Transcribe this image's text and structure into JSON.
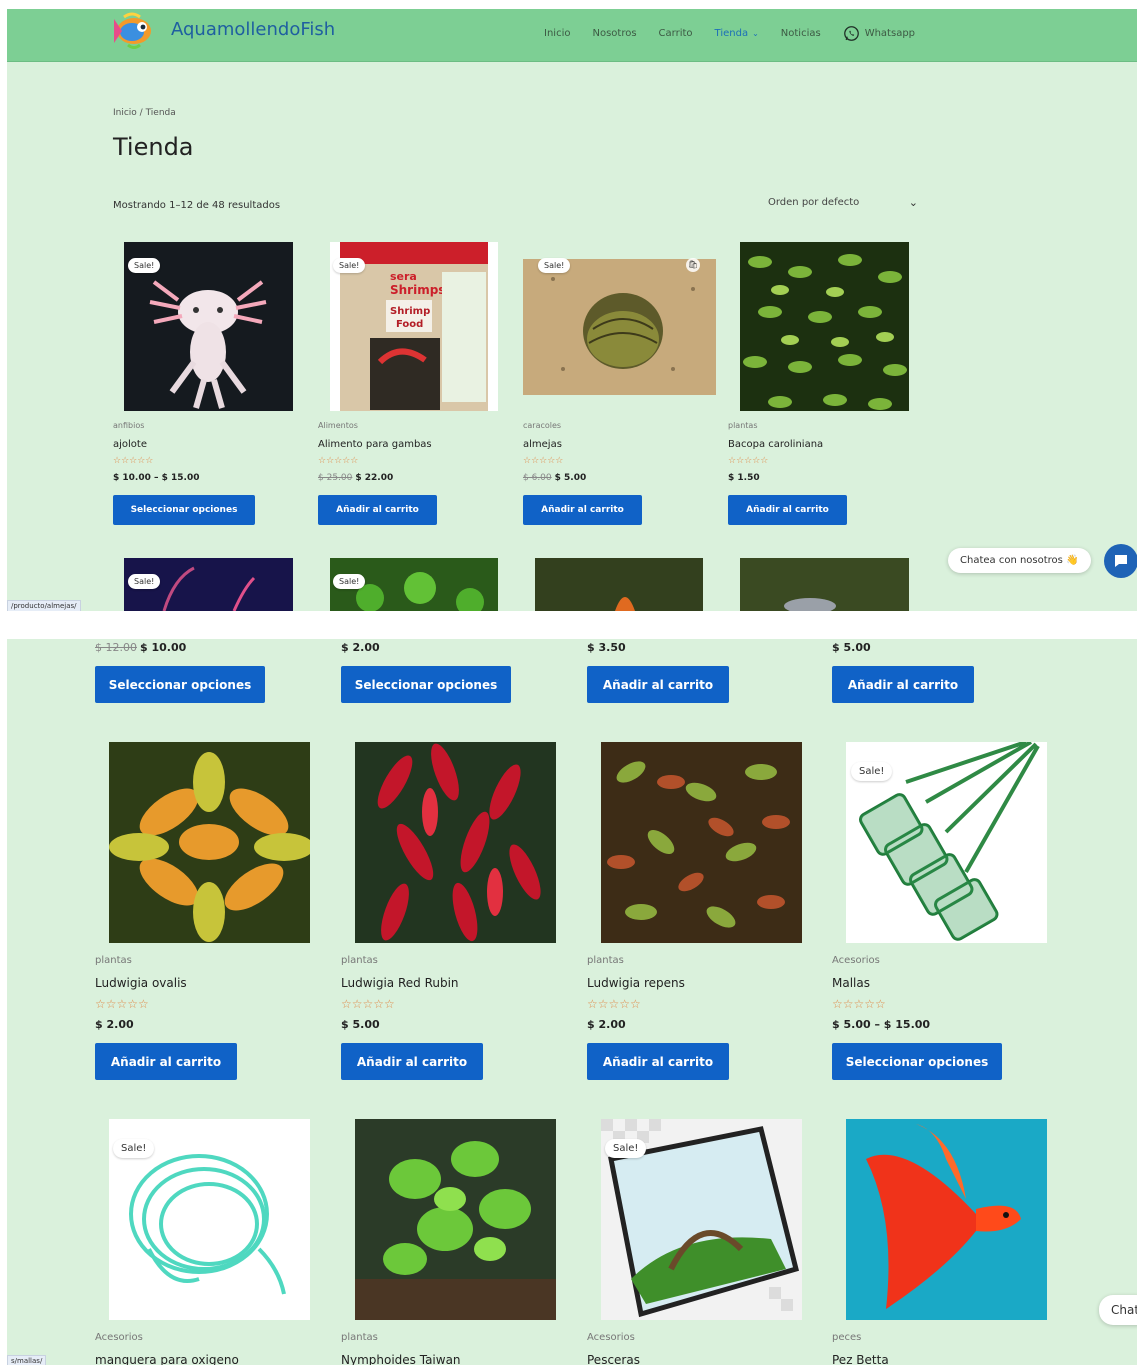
{
  "site": {
    "name": "AquamollendoFish"
  },
  "nav": {
    "items": [
      "Inicio",
      "Nosotros",
      "Carrito",
      "Tienda",
      "Noticias"
    ],
    "active": "Tienda",
    "whatsapp": "Whatsapp"
  },
  "shop": {
    "breadcrumb": "Inicio / Tienda",
    "title": "Tienda",
    "result_count": "Mostrando 1–12 de 48 resultados",
    "ordering": "Orden por defecto"
  },
  "sale_label": "Sale!",
  "rating_stars": "☆☆☆☆☆",
  "products_top": [
    {
      "category": "anfibios",
      "name": "ajolote",
      "price": "$ 10.00 – $ 15.00",
      "old_price": "",
      "button": "Seleccionar opciones",
      "sale": true
    },
    {
      "category": "Alimentos",
      "name": "Alimento para gambas",
      "price": "$ 22.00",
      "old_price": "$ 25.00",
      "button": "Añadir al carrito",
      "sale": true
    },
    {
      "category": "caracoles",
      "name": "almejas",
      "price": "$ 5.00",
      "old_price": "$ 6.00",
      "button": "Añadir al carrito",
      "sale": true
    },
    {
      "category": "plantas",
      "name": "Bacopa caroliniana",
      "price": "$ 1.50",
      "old_price": "",
      "button": "Añadir al carrito",
      "sale": false
    }
  ],
  "products_prev_row": [
    {
      "price": "$ 10.00",
      "old_price": "$ 12.00",
      "button": "Seleccionar opciones"
    },
    {
      "price": "$ 2.00",
      "old_price": "",
      "button": "Seleccionar opciones"
    },
    {
      "price": "$ 3.50",
      "old_price": "",
      "button": "Añadir al carrito"
    },
    {
      "price": "$ 5.00",
      "old_price": "",
      "button": "Añadir al carrito"
    }
  ],
  "products_mid": [
    {
      "category": "plantas",
      "name": "Ludwigia ovalis",
      "price": "$ 2.00",
      "button": "Añadir al carrito",
      "sale": false
    },
    {
      "category": "plantas",
      "name": "Ludwigia Red Rubin",
      "price": "$ 5.00",
      "button": "Añadir al carrito",
      "sale": false
    },
    {
      "category": "plantas",
      "name": "Ludwigia repens",
      "price": "$ 2.00",
      "button": "Añadir al carrito",
      "sale": false
    },
    {
      "category": "Acesorios",
      "name": "Mallas",
      "price": "$ 5.00 – $ 15.00",
      "button": "Seleccionar opciones",
      "sale": true
    }
  ],
  "products_last": [
    {
      "category": "Acesorios",
      "name": "manguera para oxigeno",
      "sale": true
    },
    {
      "category": "plantas",
      "name": "Nymphoides Taiwan",
      "sale": false
    },
    {
      "category": "Acesorios",
      "name": "Pesceras",
      "sale": true
    },
    {
      "category": "peces",
      "name": "Pez Betta",
      "sale": false
    }
  ],
  "chat": {
    "label": "Chatea con nosotros 👋",
    "label_cut": "Chat"
  },
  "status_urls": [
    "/producto/almejas/",
    "s/mallas/"
  ],
  "colors": {
    "header_bg": "#7dcf94",
    "page_bg": "#daf1dc",
    "button": "#1062c7",
    "logo_text": "#1f5fa0",
    "stars": "#e18a4a"
  }
}
